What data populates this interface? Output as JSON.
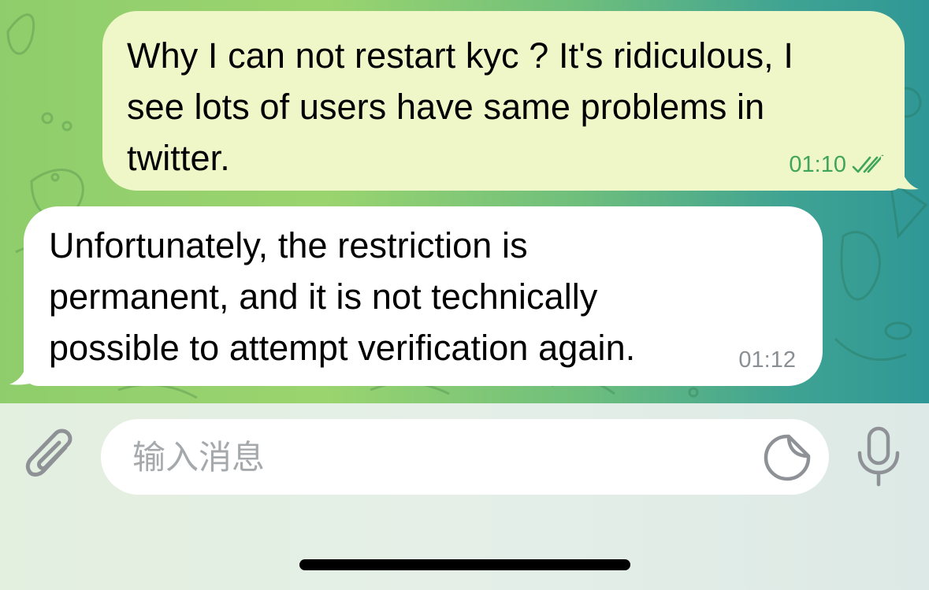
{
  "messages": [
    {
      "direction": "outgoing",
      "text": "Why I can not restart kyc ? It's ridiculous, I\nsee lots of users have same problems in\ntwitter.",
      "time": "01:10",
      "status": "read-double-check"
    },
    {
      "direction": "incoming",
      "text": "Unfortunately, the restriction is\npermanent, and it is not technically\npossible to attempt verification again.",
      "time": "01:12"
    }
  ],
  "composer": {
    "placeholder": "输入消息",
    "value": ""
  },
  "icons": {
    "attach": "paperclip-icon",
    "sticker": "sticker-icon",
    "mic": "microphone-icon",
    "read_status": "double-check-icon"
  },
  "colors": {
    "outgoing_bubble": "#eff6c8",
    "incoming_bubble": "#ffffff",
    "outgoing_time": "#3ea55a",
    "incoming_time": "#8a8f93",
    "icon_gray": "#8e9296"
  }
}
